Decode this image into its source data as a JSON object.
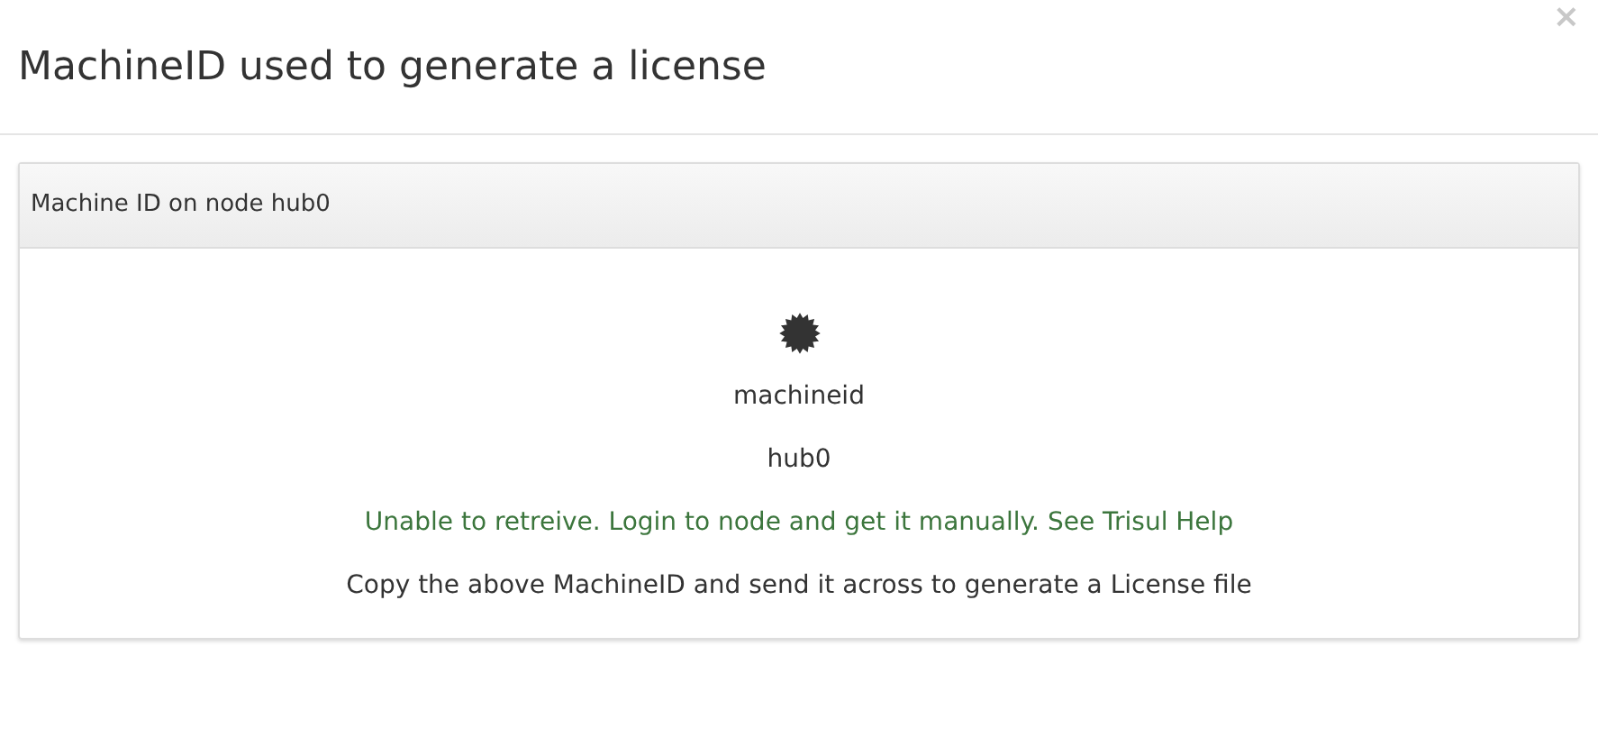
{
  "close": "×",
  "title": "MachineID used to generate a license",
  "panel": {
    "heading": "Machine ID on node hub0",
    "lines": [
      {
        "kind": "plain",
        "text": "machineid"
      },
      {
        "kind": "plain",
        "text": "hub0"
      },
      {
        "kind": "success",
        "text": "Unable to retreive. Login to node and get it manually. See Trisul Help"
      },
      {
        "kind": "plain",
        "text": "Copy the above MachineID and send it across to generate a License file"
      }
    ]
  }
}
